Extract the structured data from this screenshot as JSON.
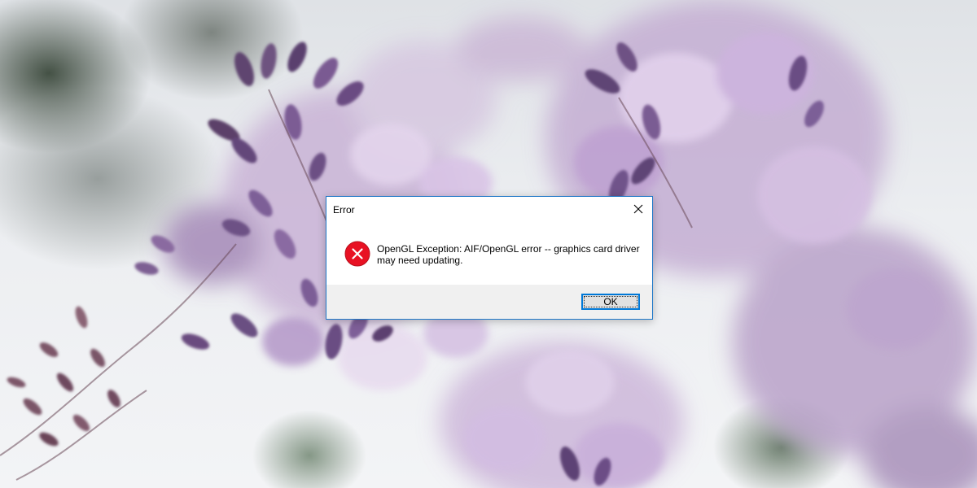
{
  "dialog": {
    "title": "Error",
    "message": "OpenGL Exception: AIF/OpenGL error -- graphics card driver may need updating.",
    "ok_label": "OK",
    "icon": "error-icon",
    "close_icon": "close-icon"
  },
  "colors": {
    "dialog_border": "#1f78c8",
    "error_icon_fill": "#e81123",
    "button_focus_border": "#0078d7",
    "footer_background": "#f0f0f0"
  },
  "desktop": {
    "wallpaper": "wisteria-flowers"
  }
}
